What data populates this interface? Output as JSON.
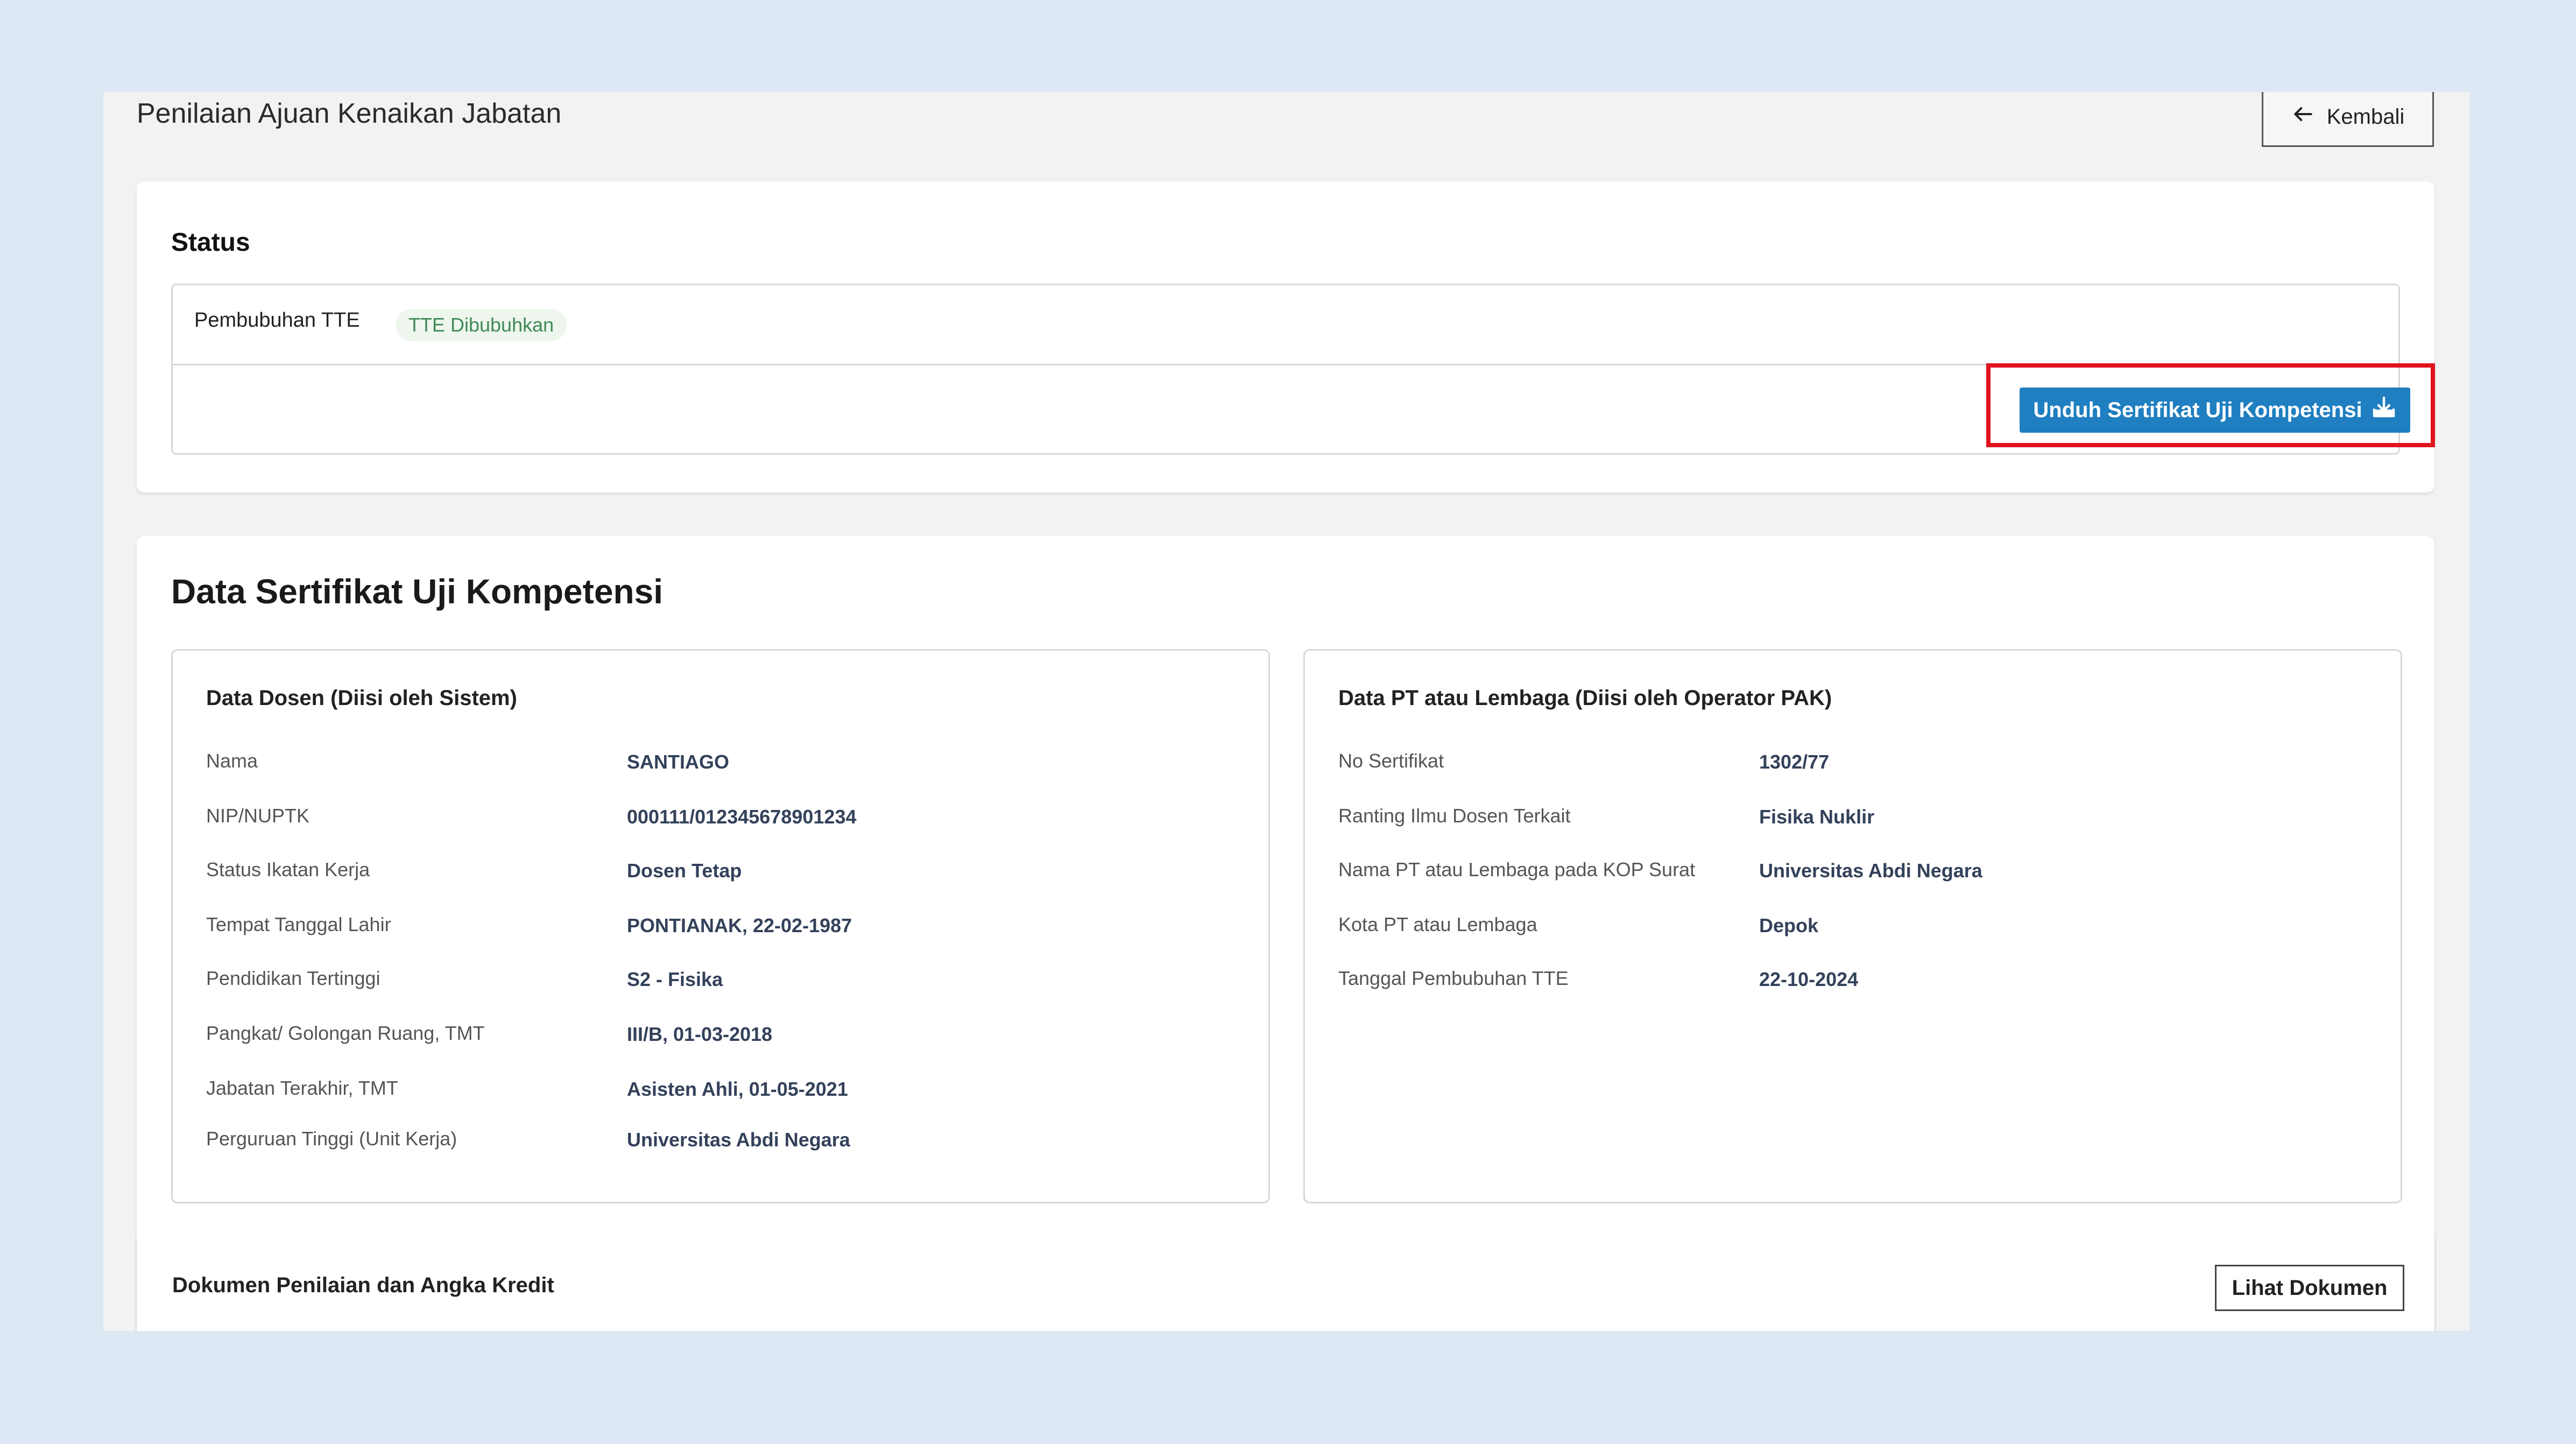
{
  "page": {
    "title": "Penilaian Ajuan Kenaikan Jabatan"
  },
  "back_button": {
    "label": "Kembali",
    "icon": "arrow-left-icon"
  },
  "status": {
    "title": "Status",
    "field_label": "Pembubuhan TTE",
    "badge": "TTE Dibubuhkan",
    "download_label": "Unduh Sertifikat Uji Kompetensi",
    "download_icon": "download-tray-icon",
    "highlight_color": "#e0141f"
  },
  "certificate": {
    "title": "Data Sertifikat Uji Kompetensi",
    "lecturer": {
      "title": "Data Dosen (Diisi oleh Sistem)",
      "rows": [
        {
          "label": "Nama",
          "value": "SANTIAGO"
        },
        {
          "label": "NIP/NUPTK",
          "value": "000111/012345678901234"
        },
        {
          "label": "Status Ikatan Kerja",
          "value": "Dosen Tetap"
        },
        {
          "label": "Tempat Tanggal Lahir",
          "value": "PONTIANAK, 22-02-1987"
        },
        {
          "label": "Pendidikan Tertinggi",
          "value": "S2 - Fisika"
        },
        {
          "label": "Pangkat/ Golongan Ruang, TMT",
          "value": "III/B, 01-03-2018"
        },
        {
          "label": "Jabatan Terakhir, TMT",
          "value": "Asisten Ahli, 01-05-2021"
        },
        {
          "label": "Perguruan Tinggi (Unit Kerja)",
          "value": "Universitas Abdi Negara"
        }
      ]
    },
    "institution": {
      "title": "Data PT atau Lembaga (Diisi oleh Operator PAK)",
      "rows": [
        {
          "label": "No Sertifikat",
          "value": "1302/77"
        },
        {
          "label": "Ranting Ilmu Dosen Terkait",
          "value": "Fisika Nuklir"
        },
        {
          "label": "Nama PT atau Lembaga pada KOP Surat",
          "value": "Universitas Abdi Negara"
        },
        {
          "label": "Kota PT atau Lembaga",
          "value": "Depok"
        },
        {
          "label": "Tanggal Pembubuhan TTE",
          "value": "22-10-2024"
        }
      ]
    }
  },
  "documents": {
    "title": "Dokumen Penilaian dan Angka Kredit",
    "view_label": "Lihat Dokumen"
  },
  "colors": {
    "accent": "#1f7fc1",
    "badge_text": "#3f8a55",
    "background": "#dde8f4"
  }
}
